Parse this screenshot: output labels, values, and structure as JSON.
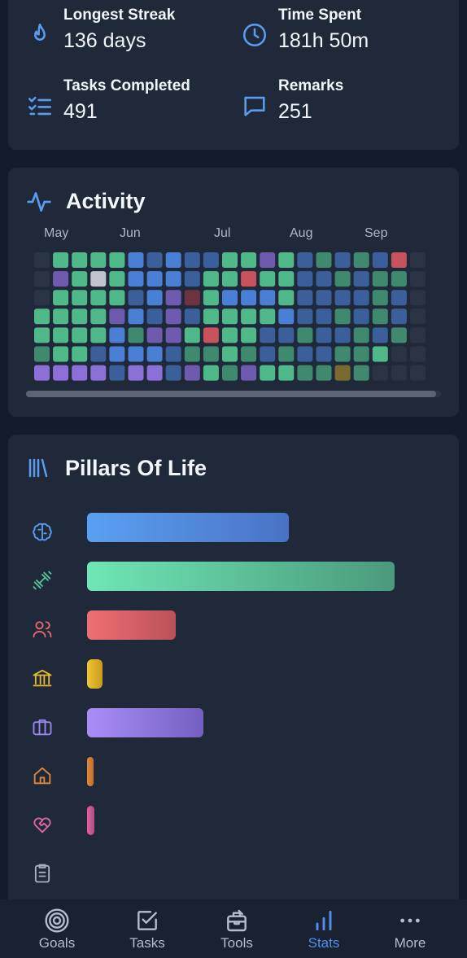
{
  "stats": {
    "longest_streak": {
      "label": "Longest Streak",
      "value": "136 days",
      "icon": "flame-icon"
    },
    "time_spent": {
      "label": "Time Spent",
      "value": "181h 50m",
      "icon": "clock-icon"
    },
    "tasks_completed": {
      "label": "Tasks Completed",
      "value": "491",
      "icon": "checklist-icon"
    },
    "remarks": {
      "label": "Remarks",
      "value": "251",
      "icon": "message-icon"
    }
  },
  "activity": {
    "title": "Activity",
    "months": [
      "May",
      "Jun",
      "Jul",
      "Aug",
      "Sep"
    ],
    "legend_colors": {
      "empty": "#2b3444",
      "green": "#4fb98a",
      "dark_green": "#3f8a6e",
      "blue": "#4a7fd6",
      "dark_blue": "#3b5f9a",
      "purple": "#6e5bb0",
      "light_purple": "#8d6fd8",
      "red": "#c9535c",
      "dark_red": "#6b3440",
      "gray": "#c0c4cc",
      "olive": "#7b6a2e"
    },
    "grid": [
      [
        "E",
        "G",
        "G",
        "G",
        "G",
        "B",
        "DB",
        "B",
        "DB",
        "DB",
        "G",
        "G",
        "P",
        "G",
        "DB",
        "DG",
        "DB",
        "DG",
        "DB",
        "R",
        "E"
      ],
      [
        "E",
        "P",
        "G",
        "W",
        "G",
        "B",
        "B",
        "B",
        "DB",
        "G",
        "G",
        "R",
        "G",
        "G",
        "DB",
        "DB",
        "DG",
        "DB",
        "DG",
        "DG",
        "E"
      ],
      [
        "E",
        "G",
        "G",
        "G",
        "G",
        "DB",
        "B",
        "P",
        "DR",
        "G",
        "B",
        "B",
        "B",
        "G",
        "DB",
        "DB",
        "DB",
        "DB",
        "DG",
        "DB",
        "E"
      ],
      [
        "G",
        "G",
        "G",
        "G",
        "P",
        "B",
        "DB",
        "P",
        "DB",
        "G",
        "G",
        "G",
        "G",
        "B",
        "DB",
        "DB",
        "DG",
        "DB",
        "DG",
        "DB",
        "E"
      ],
      [
        "G",
        "G",
        "G",
        "G",
        "B",
        "DG",
        "P",
        "P",
        "G",
        "R",
        "G",
        "G",
        "DB",
        "DB",
        "DG",
        "DB",
        "DB",
        "DG",
        "DB",
        "DG",
        "E"
      ],
      [
        "DG",
        "G",
        "G",
        "DB",
        "B",
        "B",
        "B",
        "DB",
        "DG",
        "DG",
        "G",
        "DG",
        "DB",
        "DG",
        "DB",
        "DB",
        "DG",
        "DG",
        "G",
        "E",
        "E"
      ],
      [
        "LP",
        "LP",
        "LP",
        "LP",
        "DB",
        "LP",
        "LP",
        "DB",
        "P",
        "G",
        "DG",
        "P",
        "G",
        "G",
        "DG",
        "DG",
        "O",
        "DG",
        "E",
        "E",
        "E"
      ]
    ]
  },
  "pillars": {
    "title": "Pillars Of Life",
    "items": [
      {
        "icon": "brain-icon",
        "value": 0.59,
        "color_from": "#5aa0f2",
        "color_to": "#4a72c4"
      },
      {
        "icon": "dumbbell-icon",
        "value": 0.9,
        "color_from": "#6fe6b6",
        "color_to": "#4a9a7c"
      },
      {
        "icon": "people-icon",
        "value": 0.26,
        "color_from": "#ef6f72",
        "color_to": "#b9525a"
      },
      {
        "icon": "bank-icon",
        "value": 0.045,
        "color_from": "#f0c534",
        "color_to": "#c99a1e"
      },
      {
        "icon": "briefcase-icon",
        "value": 0.34,
        "color_from": "#a98ef7",
        "color_to": "#7460c0"
      },
      {
        "icon": "home-icon",
        "value": 0.018,
        "color_from": "#e2873c",
        "color_to": "#c06f2a"
      },
      {
        "icon": "heart-handshake-icon",
        "value": 0.022,
        "color_from": "#e0609e",
        "color_to": "#b34d83"
      },
      {
        "icon": "clipboard-icon",
        "value": 0,
        "color_from": "#9aa2b1",
        "color_to": "#9aa2b1"
      }
    ],
    "icon_colors": [
      "#5a9cf0",
      "#55c496",
      "#e46a6e",
      "#e4b830",
      "#9c86ef",
      "#e0853a",
      "#e066a5",
      "#a8b0bf"
    ]
  },
  "nav": {
    "items": [
      {
        "label": "Goals",
        "icon": "target-icon",
        "active": false
      },
      {
        "label": "Tasks",
        "icon": "checkbox-icon",
        "active": false
      },
      {
        "label": "Tools",
        "icon": "toolbox-icon",
        "active": false
      },
      {
        "label": "Stats",
        "icon": "bar-chart-icon",
        "active": true
      },
      {
        "label": "More",
        "icon": "more-dots-icon",
        "active": false
      }
    ]
  }
}
